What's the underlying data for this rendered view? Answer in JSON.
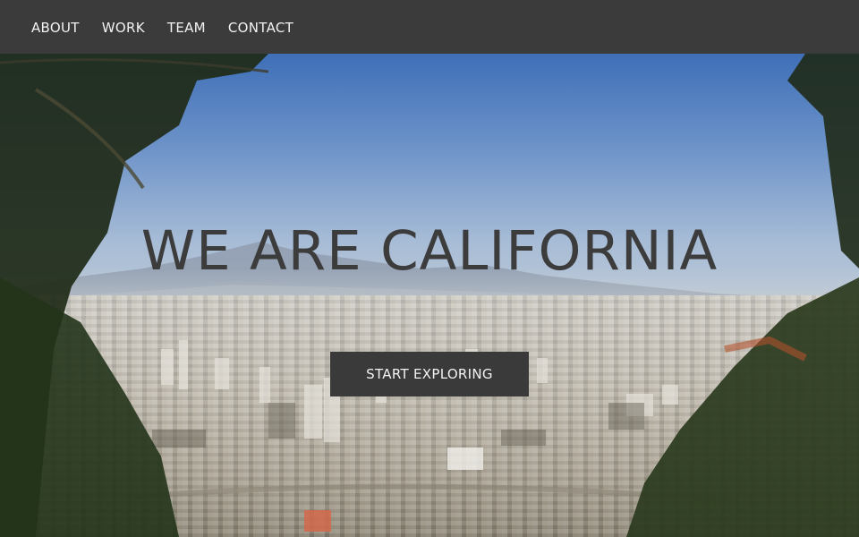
{
  "nav": {
    "items": [
      {
        "label": "ABOUT"
      },
      {
        "label": "WORK"
      },
      {
        "label": "TEAM"
      },
      {
        "label": "CONTACT"
      }
    ]
  },
  "hero": {
    "headline": "WE ARE CALIFORNIA",
    "cta_label": "START EXPLORING",
    "background": "city-skyline-through-trees"
  },
  "colors": {
    "navbar": "#3b3b3b",
    "nav_text": "#f2f2f2",
    "headline": "#3c3c3c",
    "button_bg": "#3a3a3a",
    "button_text": "#f2f2f2"
  }
}
